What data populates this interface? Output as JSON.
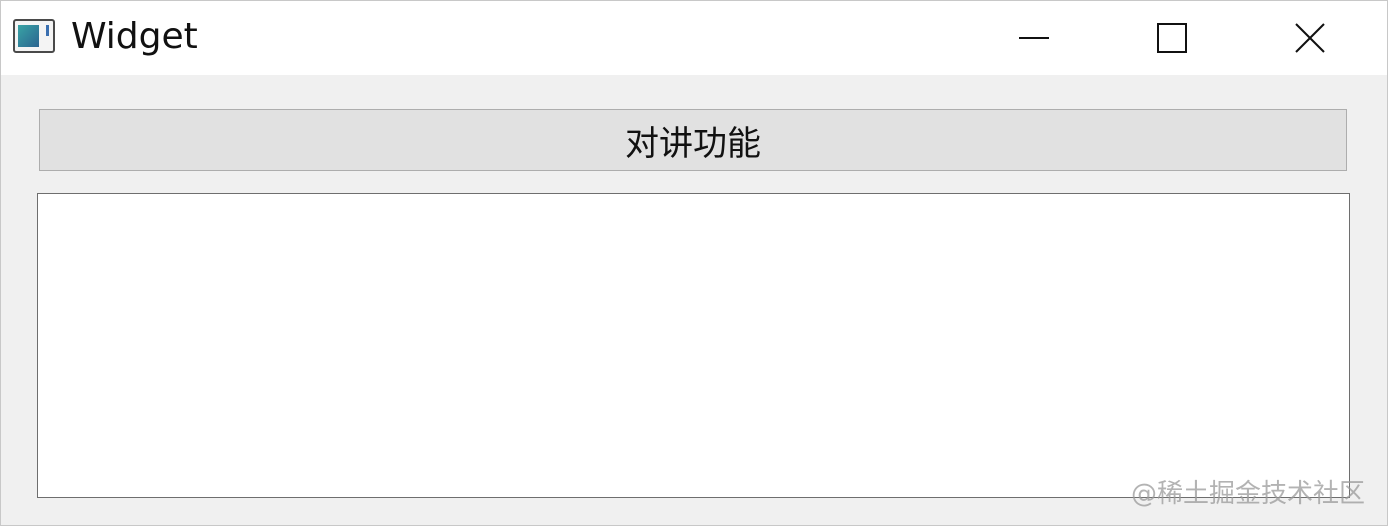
{
  "window": {
    "title": "Widget",
    "icon": "app-window-icon",
    "controls": {
      "minimize_icon": "minimize-icon",
      "maximize_icon": "maximize-icon",
      "close_icon": "close-icon"
    }
  },
  "main": {
    "intercom_button_label": "对讲功能",
    "text_area_value": ""
  },
  "watermark": {
    "text": "@稀土掘金技术社区"
  },
  "colors": {
    "titlebar_bg": "#ffffff",
    "window_bg": "#f0f0f0",
    "button_bg": "#e1e1e1",
    "button_border": "#adadad",
    "text_area_border": "#6e6e6e"
  }
}
